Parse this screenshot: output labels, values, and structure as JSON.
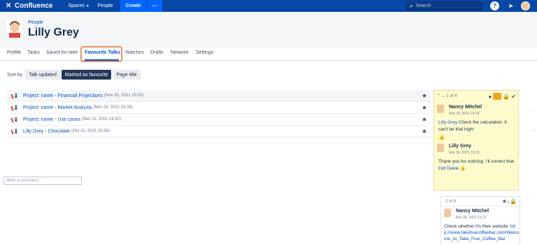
{
  "topbar": {
    "app_name": "Confluence",
    "nav": [
      "Spaces",
      "People"
    ],
    "create_label": "Create",
    "more_label": "···",
    "search_placeholder": "Search"
  },
  "header": {
    "breadcrumb": "People",
    "title": "Lilly Grey"
  },
  "tabs": [
    "Profile",
    "Tasks",
    "Saved for later",
    "Favourite Talks",
    "Watches",
    "Drafts",
    "Network",
    "Settings"
  ],
  "sort": {
    "label": "Sort by",
    "options": [
      "Talk updated",
      "Marked as favourite",
      "Page title"
    ],
    "selected": "Marked as favourite"
  },
  "talks": [
    {
      "title": "Project: name - Financial Projections",
      "date": "(Nov 30, 2021 15:20)"
    },
    {
      "title": "Project: name - Market Analysis",
      "date": "(Nov 29, 2021 18:35)"
    },
    {
      "title": "Project: name - Use cases",
      "date": "(Dec 11, 2021 19:52)"
    },
    {
      "title": "Lilly Grey - Chocolate",
      "date": "(Oct 21, 2021 10:38)"
    }
  ],
  "popup": {
    "counter": "1 of 4",
    "comments": [
      {
        "author": "Nancy Mitchel",
        "date": "Nov 30, 2021 14:41",
        "mention": "Lilly Grey",
        "text": " Check the calculation. It can't be that high!"
      },
      {
        "author": "Lilly Grey",
        "date": "Nov 30, 2021 15:20",
        "text": "Thank you for noticing. I'll correct that.",
        "actions": "Edit  Delete"
      }
    ],
    "input_placeholder": "Write a comment..."
  },
  "card2": {
    "counter": "2 of 4",
    "author": "Nancy Mitchel",
    "date": "Nov 26, 2021 21:21",
    "text": "Check whether it's their website:",
    "link": "http://www.takefivecoffeebar.com/Welcome_to_Take_Five_Coffee_Bar"
  },
  "colors": {
    "topbar": "#0747a6",
    "accent": "#0052cc",
    "popup_bg": "#fffbcc",
    "highlight": "#e8935c"
  }
}
